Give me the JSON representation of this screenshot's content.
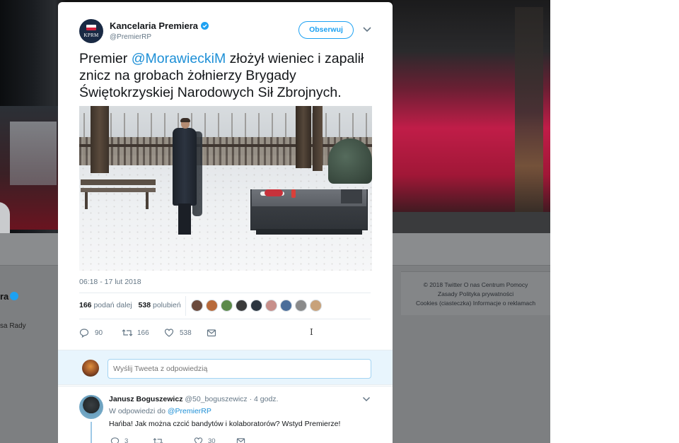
{
  "background": {
    "profile_name_fragment": "ra",
    "profile_sub_fragment": "sa Rady",
    "footer": {
      "line1": "© 2018 Twitter    O nas    Centrum Pomocy",
      "line2": "Zasady    Polityka prywatności",
      "line3": "Cookies (ciasteczka)    Informacje o reklamach"
    }
  },
  "tweet": {
    "author_name": "Kancelaria Premiera",
    "author_handle": "@PremierRP",
    "avatar_label": "KPRM",
    "follow_label": "Obserwuj",
    "text_before": "Premier ",
    "mention": "@MorawieckiM",
    "text_after": " złożył wieniec i zapalił znicz na grobach żołnierzy Brygady Świętokrzyskiej Narodowych Sił Zbrojnych.",
    "timestamp": "06:18 - 17 lut 2018",
    "retweets_count": "166",
    "retweets_label": "podań dalej",
    "likes_count": "538",
    "likes_label": "polubień",
    "likers_count": 9,
    "actions": {
      "reply_count": "90",
      "retweet_count": "166",
      "like_count": "538"
    }
  },
  "reply_box": {
    "placeholder": "Wyślij Tweeta z odpowiedzią"
  },
  "reply": {
    "name": "Janusz Boguszewicz",
    "handle": "@50_boguszewicz",
    "separator": " · ",
    "time": "4 godz.",
    "in_reply_prefix": "W odpowiedzi do ",
    "in_reply_handle": "@PremierRP",
    "text": "Hańba! Jak można czcić bandytów i kolaboratorów? Wstyd Premierze!",
    "actions": {
      "reply_count": "3",
      "retweet_count": "",
      "like_count": "30"
    }
  },
  "colors": {
    "twitter_blue": "#1da1f2",
    "link_blue": "#1d8fd6",
    "secondary_text": "#657786",
    "reply_box_bg": "#e8f5fd"
  }
}
